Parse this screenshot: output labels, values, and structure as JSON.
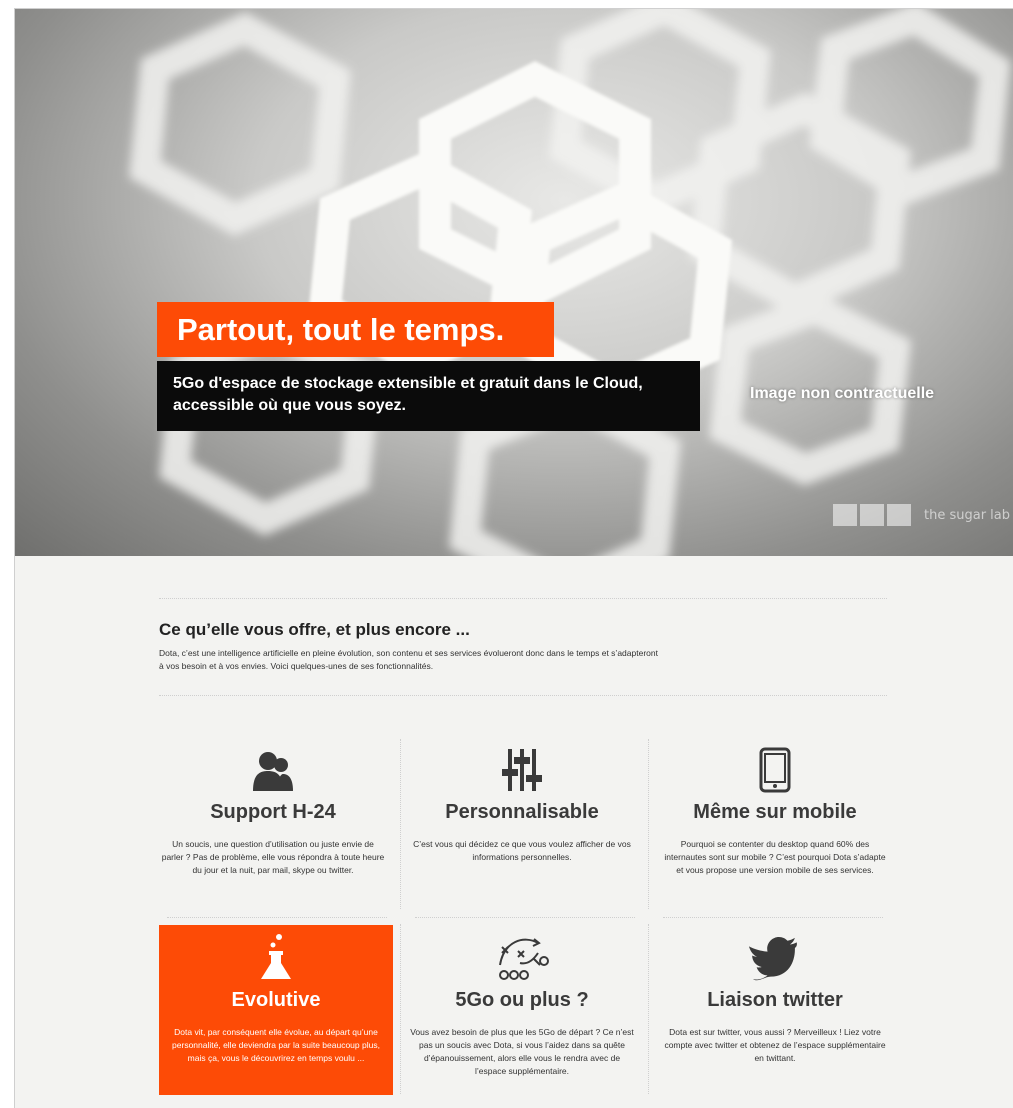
{
  "hero": {
    "title": "Partout, tout le temps.",
    "subtitle_line1": "5Go d'espace de stockage extensible et gratuit dans le Cloud,",
    "subtitle_line2": "accessible où que vous soyez.",
    "note": "Image non contractuelle",
    "watermark": "the sugar lab"
  },
  "intro": {
    "title": "Ce qu’elle vous offre, et plus encore ...",
    "text": "Dota, c’est une intelligence artificielle en pleine évolution, son contenu et ses services évolueront donc dans le temps et s’adapteront à vos besoin et à vos envies. Voici quelques-unes de ses fonctionnalités."
  },
  "features": [
    {
      "icon": "users-icon",
      "title": "Support H-24",
      "text": "Un soucis, une question d’utilisation ou juste envie de parler ? Pas de problème, elle vous répondra à toute heure du jour et la nuit, par mail, skype ou twitter."
    },
    {
      "icon": "sliders-icon",
      "title": "Personnalisable",
      "text": "C’est vous qui décidez ce que vous voulez afficher de vos informations personnelles."
    },
    {
      "icon": "mobile-icon",
      "title": "Même sur mobile",
      "text": "Pourquoi se contenter du desktop quand 60% des internautes sont sur mobile ? C’est pourquoi Dota s’adapte et vous propose une version mobile de ses services."
    },
    {
      "icon": "flask-icon",
      "title": "Evolutive",
      "text": "Dota vit, par conséquent elle évolue, au départ qu’une personnalité, elle deviendra par la suite beaucoup plus, mais ça, vous le découvrirez en temps voulu ..."
    },
    {
      "icon": "strategy-icon",
      "title": "5Go ou plus ?",
      "text": "Vous avez besoin de plus que les 5Go de départ ? Ce n’est pas un soucis avec Dota, si vous l’aidez dans sa quête d’épanouissement, alors elle vous le rendra avec de l’espace supplémentaire."
    },
    {
      "icon": "twitter-bird-icon",
      "title": "Liaison twitter",
      "text": "Dota est sur twitter, vous aussi ? Merveilleux ! Liez votre compte avec twitter et obtenez de l’espace supplémentaire en twittant."
    }
  ],
  "colors": {
    "accent": "#fd4b06",
    "dark": "#0b0b0b",
    "page_bg": "#f3f3f1"
  }
}
